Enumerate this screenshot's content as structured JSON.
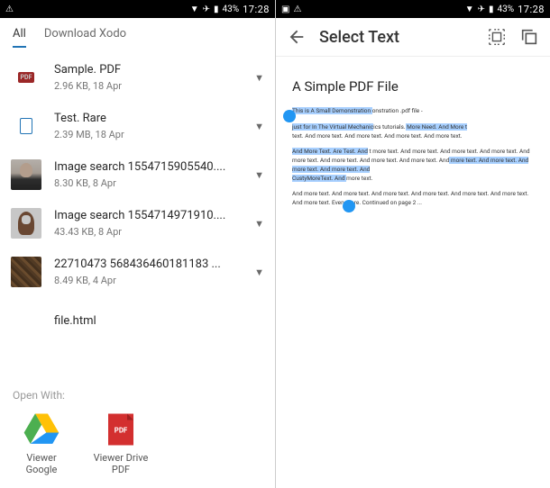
{
  "status": {
    "battery": "43%",
    "time": "17:28"
  },
  "left": {
    "tabs": {
      "all": "All",
      "download": "Download Xodo"
    },
    "files": [
      {
        "name": "Sample. PDF",
        "meta": "2.96 KB,  18 Apr"
      },
      {
        "name": "Test. Rare",
        "meta": "2.39 MB,  18 Apr"
      },
      {
        "name": "Image  search  1554715905540....",
        "meta": "8.30 KB,  8 Apr"
      },
      {
        "name": "Image  search  1554714971910....",
        "meta": "43.43 KB,  8 Apr"
      },
      {
        "name": "22710473  568436460181183 ...",
        "meta": "8.49 KB,  4 Apr"
      },
      {
        "name": "file.html",
        "meta": ""
      }
    ],
    "open_with": {
      "title": "Open With:",
      "apps": [
        {
          "label": "Viewer Google"
        },
        {
          "label": "Viewer Drive PDF"
        }
      ]
    }
  },
  "right": {
    "toolbar_title": "Select Text",
    "doc_title": "A Simple PDF File",
    "p1a": "This is A Small Demonstration ",
    "p1b": "onstration .pdf file -",
    "p2a": "just for In The Virtual Mechanic",
    "p2b": "ics tutorials.",
    "p2c": " More Need. And More t",
    "p2d": "text. And more text. And more text. And more text. And more text.",
    "p3a": "And More Text. Are Test. And",
    "p3b": " t more text. And more text. And more text. And more text. And more text. And more text. And more text. And more text. And",
    "p3c": " more text. And more text. And more text. And more text. And ",
    "p3d": "CustyMoreText. And ",
    "p3e": "more text.",
    "p4": "And more text. And more text. And more text. And more text. And more text. And more text. And more text. Even more. Continued on page 2 ..."
  }
}
